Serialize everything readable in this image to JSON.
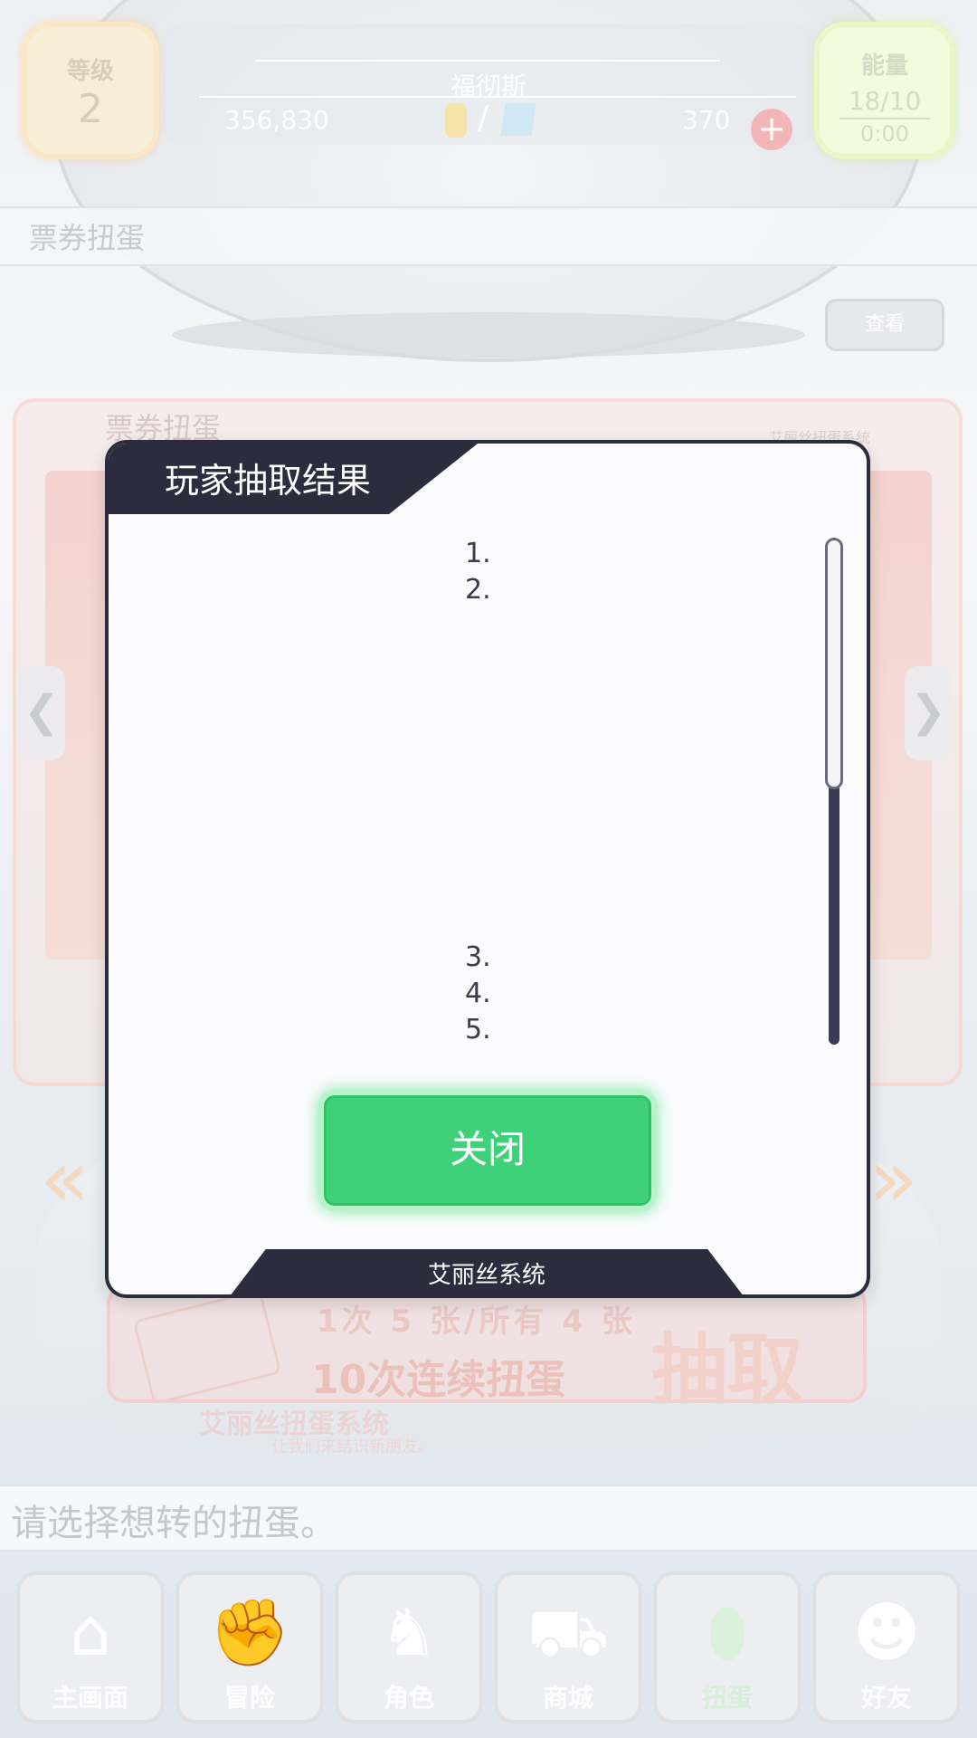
{
  "hud": {
    "level_label": "等级",
    "level_value": "2",
    "player_name": "福彻斯",
    "coins": "356,830",
    "currency_separator": "/",
    "gems": "370",
    "plus_symbol": "+",
    "energy_label": "能量",
    "energy_value": "18/10",
    "energy_timer": "0:00"
  },
  "page": {
    "section_title": "票券扭蛋",
    "view_button": "查看",
    "hint": "请选择想转的扭蛋。"
  },
  "banner": {
    "tab_label": "票券扭蛋",
    "system_label": "艾丽丝扭蛋系统",
    "arrow_left": "❮",
    "arrow_right": "❯",
    "chevron_left": "«",
    "chevron_right": "»",
    "draw_count": "1次 5 张/所有 4 张",
    "draw_label": "10次连续扭蛋",
    "draw_action": "抽取",
    "ticket_text": "票券",
    "draw_system": "艾丽丝扭蛋系统",
    "draw_subtext": "让我们来结识新朋友。"
  },
  "modal": {
    "title": "玩家抽取结果",
    "results": [
      "1.",
      "2.",
      "3.",
      "4.",
      "5."
    ],
    "close_button": "关闭",
    "footer": "艾丽丝系统"
  },
  "nav": {
    "items": [
      {
        "label": "主画面",
        "icon": "home-icon"
      },
      {
        "label": "冒险",
        "icon": "fist-icon"
      },
      {
        "label": "角色",
        "icon": "rabbit-icon"
      },
      {
        "label": "商城",
        "icon": "cart-icon"
      },
      {
        "label": "扭蛋",
        "icon": "egg-icon"
      },
      {
        "label": "好友",
        "icon": "friends-icon"
      }
    ]
  },
  "colors": {
    "modal_dark": "#2b2c3e",
    "close_green": "#3ed17a"
  }
}
